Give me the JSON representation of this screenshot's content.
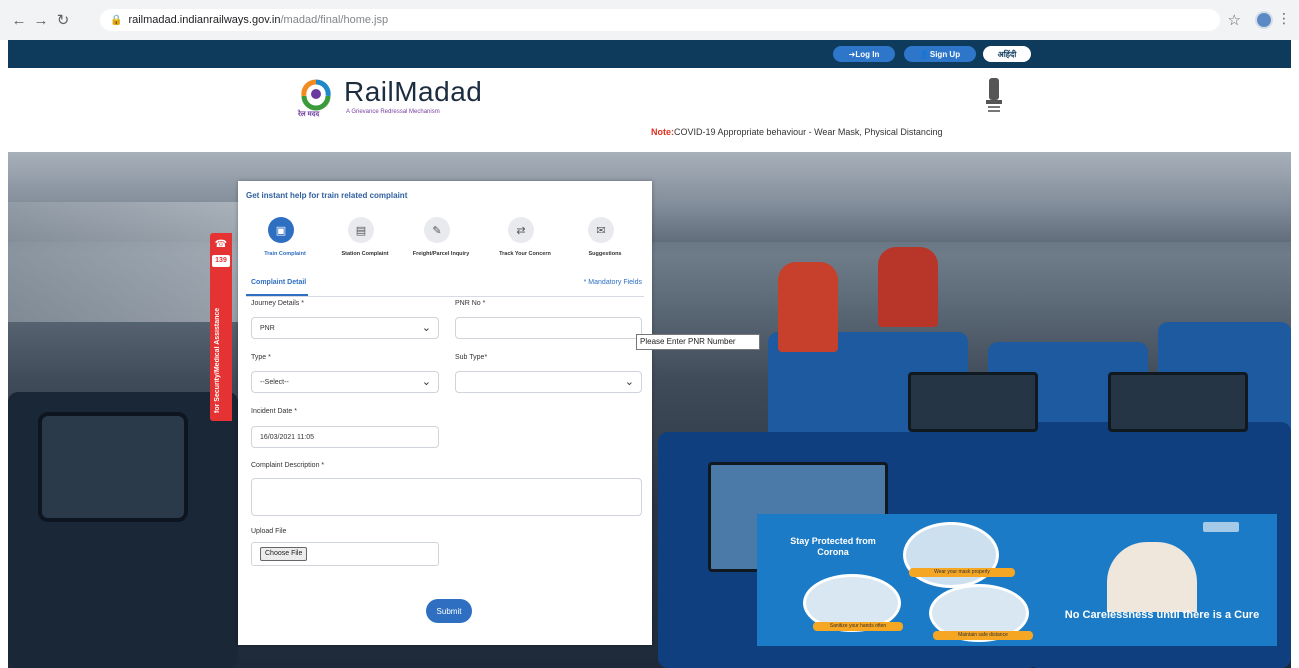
{
  "browser": {
    "url_host": "railmadad.indianrailways.gov.in",
    "url_path": "/madad/final/home.jsp"
  },
  "topbar": {
    "login_label": "Log In",
    "signup_label": "Sign Up",
    "hindi_label": "हिंदी"
  },
  "header": {
    "brand": "RailMadad",
    "logo_sub": "रेल मदद",
    "tagline": "A Grievance Redressal Mechanism",
    "note_label": "Note:",
    "note_text": "COVID-19 Appropriate behaviour - Wear Mask, Physical Distancing"
  },
  "helpline": {
    "number": "139",
    "text": "for Security/Medical Assistance"
  },
  "card": {
    "title": "Get instant help for train related complaint",
    "tabs": [
      {
        "label": "Train Complaint"
      },
      {
        "label": "Station Complaint"
      },
      {
        "label": "Freight/Parcel Inquiry"
      },
      {
        "label": "Track Your Concern"
      },
      {
        "label": "Suggestions"
      }
    ],
    "section": "Complaint Detail",
    "mandatory": "* Mandatory Fields",
    "journey_label": "Journey Details *",
    "journey_value": "PNR",
    "pnr_label": "PNR No *",
    "pnr_value": "",
    "type_label": "Type *",
    "type_value": "--Select--",
    "subtype_label": "Sub Type*",
    "subtype_value": "",
    "date_label": "Incident Date *",
    "date_value": "16/03/2021 11:05",
    "desc_label": "Complaint Description *",
    "desc_value": "",
    "upload_label": "Upload File",
    "choose_file": "Choose File",
    "submit": "Submit"
  },
  "tooltip": "Please Enter PNR Number",
  "banner": {
    "left_text": "Stay Protected from Corona",
    "cap1": "Wear your mask properly",
    "cap2": "Sanitize your hands often",
    "cap3": "Maintain safe distance",
    "right_text": "No Carelessness until there is a Cure"
  }
}
